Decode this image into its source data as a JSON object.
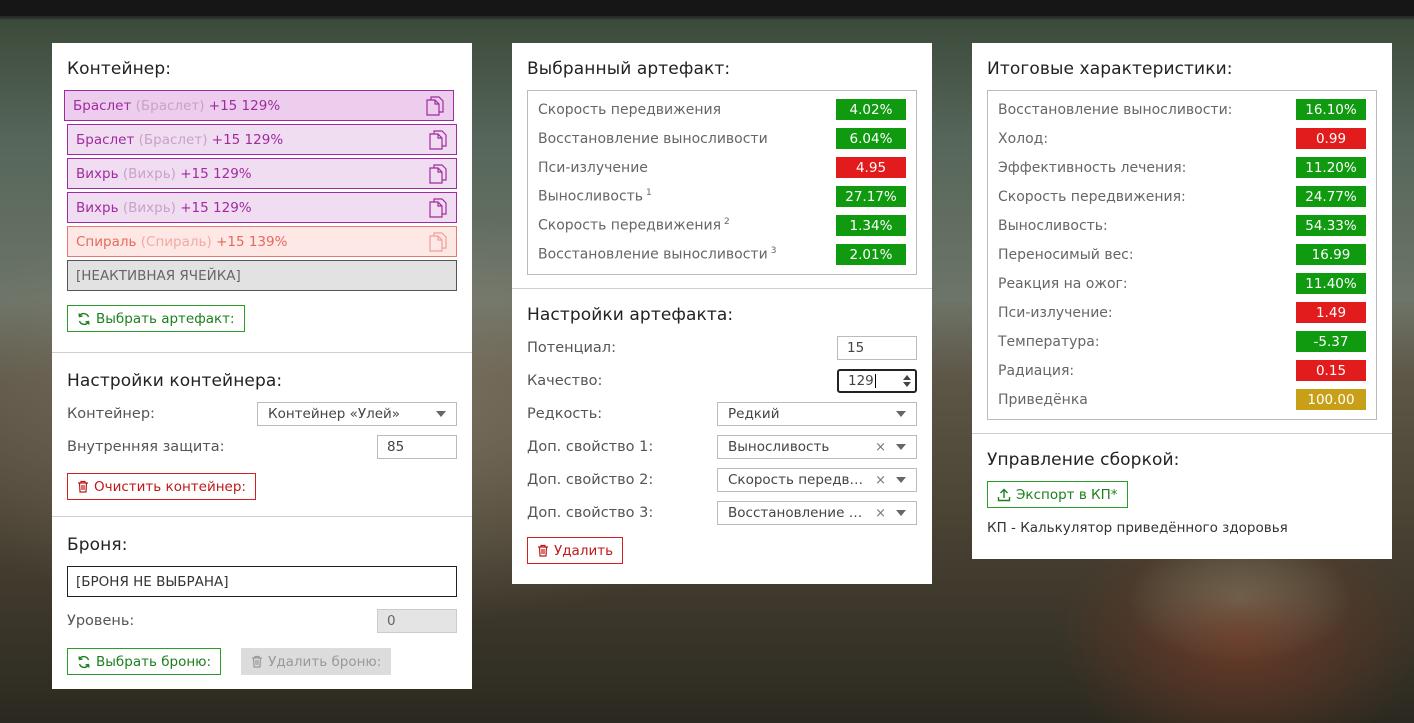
{
  "container_panel": {
    "title": "Контейнер:",
    "slots": [
      {
        "name": "Браслет",
        "type": "(Браслет)",
        "level": "+15 129%"
      },
      {
        "name": "Браслет",
        "type": "(Браслет)",
        "level": "+15 129%"
      },
      {
        "name": "Вихрь",
        "type": "(Вихрь)",
        "level": "+15 129%"
      },
      {
        "name": "Вихрь",
        "type": "(Вихрь)",
        "level": "+15 129%"
      },
      {
        "name": "Спираль",
        "type": "(Спираль)",
        "level": "+15 139%"
      }
    ],
    "inactive_slot": "[НЕАКТИВНАЯ ЯЧЕЙКА]",
    "select_artifact_button": "Выбрать артефакт:"
  },
  "container_settings": {
    "title": "Настройки контейнера:",
    "container_label": "Контейнер:",
    "container_value": "Контейнер «Улей»",
    "protection_label": "Внутренняя защита:",
    "protection_value": "85",
    "clear_button": "Очистить контейнер:"
  },
  "armor": {
    "title": "Броня:",
    "armor_value": "[БРОНЯ НЕ ВЫБРАНА]",
    "level_label": "Уровень:",
    "level_value": "0",
    "select_button": "Выбрать броню:",
    "delete_button": "Удалить броню:"
  },
  "selected_artifact": {
    "title": "Выбранный артефакт:",
    "stats": [
      {
        "label": "Скорость передвижения",
        "sup": "",
        "value": "4.02%",
        "color": "green"
      },
      {
        "label": "Восстановление выносливости",
        "sup": "",
        "value": "6.04%",
        "color": "green"
      },
      {
        "label": "Пси-излучение",
        "sup": "",
        "value": "4.95",
        "color": "red"
      },
      {
        "label": "Выносливость",
        "sup": "1",
        "value": "27.17%",
        "color": "green"
      },
      {
        "label": "Скорость передвижения",
        "sup": "2",
        "value": "1.34%",
        "color": "green"
      },
      {
        "label": "Восстановление выносливости",
        "sup": "3",
        "value": "2.01%",
        "color": "green"
      }
    ]
  },
  "artifact_settings": {
    "title": "Настройки артефакта:",
    "potential_label": "Потенциал:",
    "potential_value": "15",
    "quality_label": "Качество:",
    "quality_value": "129",
    "rarity_label": "Редкость:",
    "rarity_value": "Редкий",
    "prop1_label": "Доп. свойство 1:",
    "prop1_value": "Выносливость",
    "prop2_label": "Доп. свойство 2:",
    "prop2_value": "Скорость передвижения",
    "prop3_label": "Доп. свойство 3:",
    "prop3_value": "Восстановление выносливости",
    "delete_button": "Удалить"
  },
  "totals": {
    "title": "Итоговые характеристики:",
    "stats": [
      {
        "label": "Восстановление выносливости:",
        "value": "16.10%",
        "color": "green"
      },
      {
        "label": "Холод:",
        "value": "0.99",
        "color": "red"
      },
      {
        "label": "Эффективность лечения:",
        "value": "11.20%",
        "color": "green"
      },
      {
        "label": "Скорость передвижения:",
        "value": "24.77%",
        "color": "green"
      },
      {
        "label": "Выносливость:",
        "value": "54.33%",
        "color": "green"
      },
      {
        "label": "Переносимый вес:",
        "value": "16.99",
        "color": "green"
      },
      {
        "label": "Реакция на ожог:",
        "value": "11.40%",
        "color": "green"
      },
      {
        "label": "Пси-излучение:",
        "value": "1.49",
        "color": "red"
      },
      {
        "label": "Температура:",
        "value": "-5.37",
        "color": "green"
      },
      {
        "label": "Радиация:",
        "value": "0.15",
        "color": "red"
      },
      {
        "label": "Приведёнка",
        "value": "100.00",
        "color": "yellow"
      }
    ]
  },
  "build": {
    "title": "Управление сборкой:",
    "export_button": "Экспорт в КП*",
    "footnote": "КП - Калькулятор приведённого здоровья"
  },
  "colors": {
    "green": "#109a10",
    "red": "#e21c1c",
    "yellow": "#c8a018",
    "purple": "#a02ba0"
  }
}
